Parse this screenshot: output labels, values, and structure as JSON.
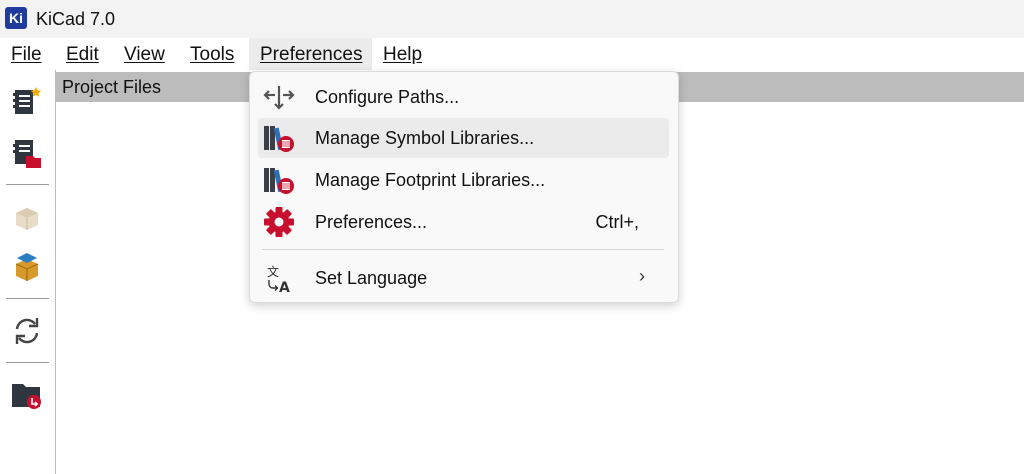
{
  "window": {
    "title": "KiCad 7.0",
    "logo_text": "Ki"
  },
  "menubar": {
    "items": [
      {
        "label": "File"
      },
      {
        "label": "Edit"
      },
      {
        "label": "View"
      },
      {
        "label": "Tools"
      },
      {
        "label": "Preferences"
      },
      {
        "label": "Help"
      }
    ],
    "active": "Preferences"
  },
  "panel": {
    "title": "Project Files"
  },
  "toolbar": {
    "buttons": [
      "new-project-icon",
      "open-project-icon",
      "archive-icon",
      "unarchive-icon",
      "refresh-icon",
      "open-folder-icon"
    ]
  },
  "dropdown": {
    "items": [
      {
        "label": "Configure Paths...",
        "icon": "configure-paths-icon"
      },
      {
        "label": "Manage Symbol Libraries...",
        "icon": "symbol-libraries-icon",
        "highlighted": true
      },
      {
        "label": "Manage Footprint Libraries...",
        "icon": "footprint-libraries-icon"
      },
      {
        "label": "Preferences...",
        "icon": "gear-icon",
        "shortcut": "Ctrl+,"
      },
      {
        "label": "Set Language",
        "icon": "language-icon",
        "submenu_arrow": "›"
      }
    ]
  },
  "colors": {
    "accent_red": "#c8102e",
    "brand_blue": "#1f3c9c",
    "highlight": "#ebebeb"
  }
}
